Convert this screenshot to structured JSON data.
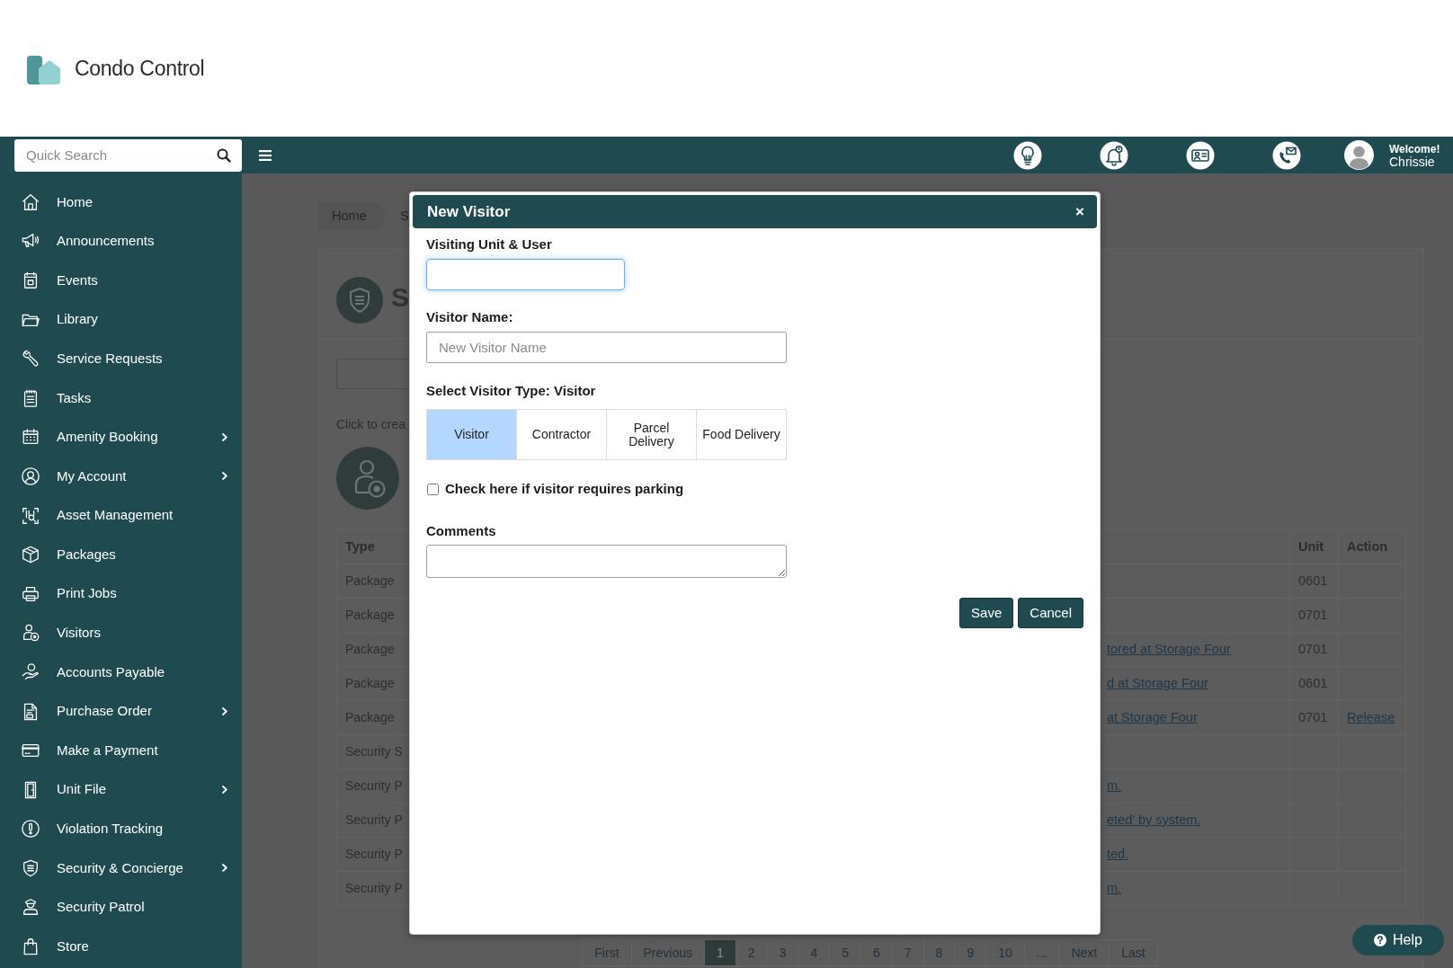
{
  "header": {
    "brand": "Condo Control"
  },
  "top_bar": {
    "search": {
      "placeholder": "Quick Search"
    },
    "user": {
      "greeting": "Welcome!",
      "name": "Chrissie"
    }
  },
  "sidebar": {
    "items": [
      {
        "label": "Home",
        "submenu": false
      },
      {
        "label": "Announcements",
        "submenu": false
      },
      {
        "label": "Events",
        "submenu": false
      },
      {
        "label": "Library",
        "submenu": false
      },
      {
        "label": "Service Requests",
        "submenu": false
      },
      {
        "label": "Tasks",
        "submenu": false
      },
      {
        "label": "Amenity Booking",
        "submenu": true
      },
      {
        "label": "My Account",
        "submenu": true
      },
      {
        "label": "Asset Management",
        "submenu": false
      },
      {
        "label": "Packages",
        "submenu": false
      },
      {
        "label": "Print Jobs",
        "submenu": false
      },
      {
        "label": "Visitors",
        "submenu": false
      },
      {
        "label": "Accounts Payable",
        "submenu": false
      },
      {
        "label": "Purchase Order",
        "submenu": true
      },
      {
        "label": "Make a Payment",
        "submenu": false
      },
      {
        "label": "Unit File",
        "submenu": true
      },
      {
        "label": "Violation Tracking",
        "submenu": false
      },
      {
        "label": "Security & Concierge",
        "submenu": true
      },
      {
        "label": "Security Patrol",
        "submenu": false
      },
      {
        "label": "Store",
        "submenu": false
      }
    ]
  },
  "page": {
    "breadcrumb": [
      "Home",
      "S"
    ],
    "title": "S",
    "hint": "Click to crea",
    "table": {
      "columns": [
        "Type",
        "Unit",
        "Action"
      ],
      "rows": [
        {
          "type": "Package",
          "unit": "0601"
        },
        {
          "type": "Package",
          "unit": "0701"
        },
        {
          "type": "Package",
          "column_2": "tored at Storage Four",
          "unit": "0701"
        },
        {
          "type": "Package",
          "column_2": "d at Storage Four",
          "unit": "0601"
        },
        {
          "type": "Package",
          "column_2": "at Storage Four",
          "unit": "0701",
          "action": "Release"
        },
        {
          "type": "Security S"
        },
        {
          "type": "Security P",
          "column_2": "m."
        },
        {
          "type": "Security P",
          "column_2": "eted' by system."
        },
        {
          "type": "Security P",
          "column_2": "ted."
        },
        {
          "type": "Security P",
          "column_2": "m."
        }
      ]
    },
    "pagination": [
      {
        "label": "First",
        "selected": false
      },
      {
        "label": "Previous",
        "selected": false
      },
      {
        "label": "1",
        "selected": true
      },
      {
        "label": "2",
        "selected": false
      },
      {
        "label": "3",
        "selected": false
      },
      {
        "label": "4",
        "selected": false
      },
      {
        "label": "5",
        "selected": false
      },
      {
        "label": "6",
        "selected": false
      },
      {
        "label": "7",
        "selected": false
      },
      {
        "label": "8",
        "selected": false
      },
      {
        "label": "9",
        "selected": false
      },
      {
        "label": "10",
        "selected": false
      },
      {
        "label": "...",
        "selected": false
      },
      {
        "label": "Next",
        "selected": false
      },
      {
        "label": "Last",
        "selected": false
      }
    ]
  },
  "modal": {
    "title": "New Visitor",
    "close": "×",
    "unit_user": {
      "label": "Visiting Unit & User",
      "focused": true
    },
    "visitor_name": {
      "label": "Visitor Name:",
      "placeholder": "New Visitor Name"
    },
    "visitor_type": {
      "label": "Select Visitor Type: Visitor",
      "options": [
        {
          "label": "Visitor",
          "selected": true
        },
        {
          "label": "Contractor",
          "selected": false
        },
        {
          "label": "Parcel Delivery",
          "selected": false
        },
        {
          "label": "Food Delivery",
          "selected": false
        }
      ]
    },
    "parking": {
      "label": "Check here if visitor requires parking",
      "checked": false
    },
    "comments": {
      "label": "Comments"
    },
    "buttons": [
      "Save",
      "Cancel"
    ]
  },
  "help": {
    "label": "Help"
  }
}
